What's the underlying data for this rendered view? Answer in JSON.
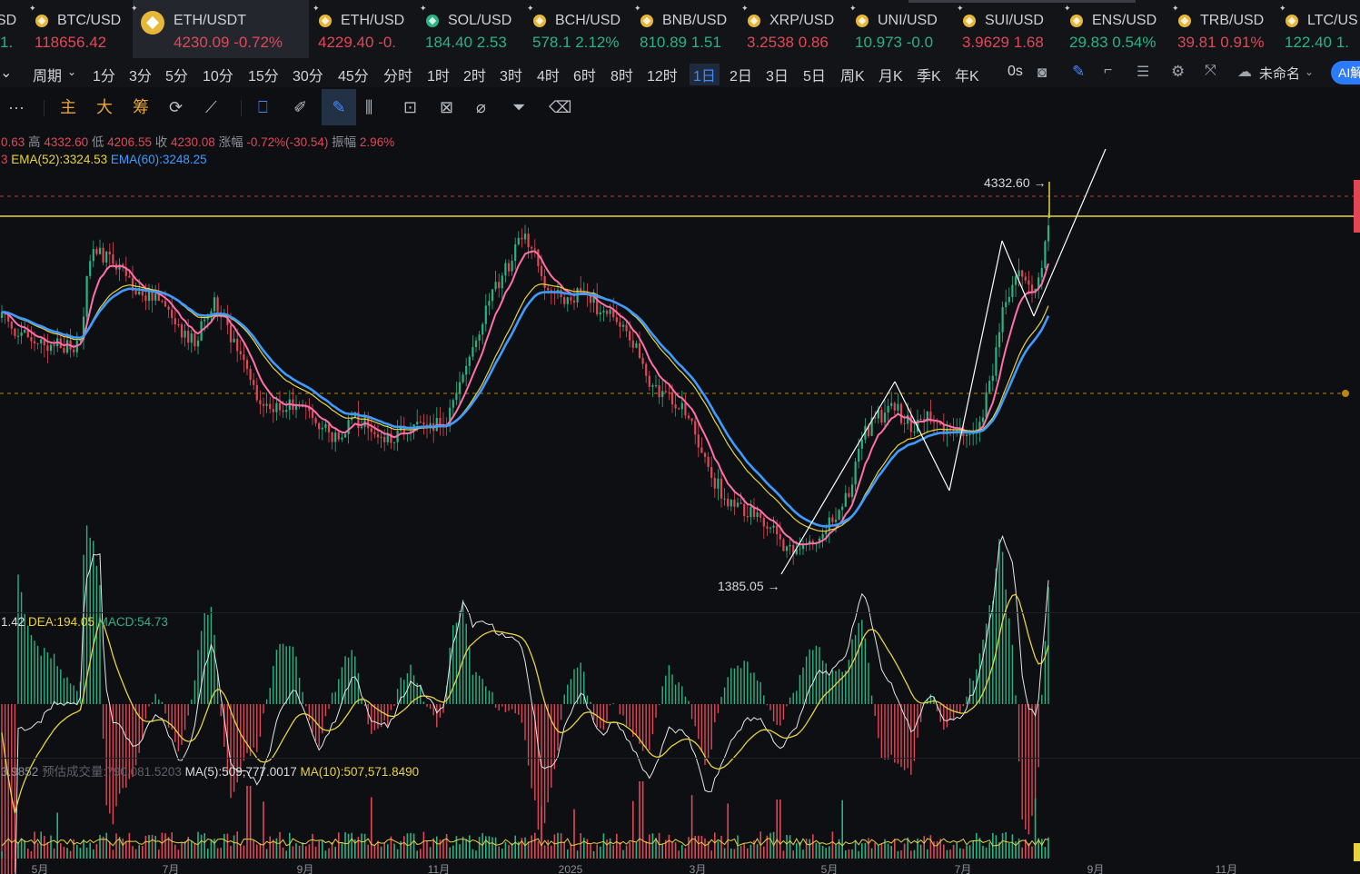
{
  "tickers": [
    {
      "symbol": "SD",
      "price": "1.",
      "dir": "up",
      "active": false
    },
    {
      "symbol": "BTC/USD",
      "price": "118656.42",
      "dir": "down",
      "active": false
    },
    {
      "symbol": "ETH/USDT",
      "price": "4230.09",
      "change": "-0.72%",
      "dir": "down",
      "active": true
    },
    {
      "symbol": "ETH/USD",
      "price": "4229.40",
      "change": "-0.",
      "dir": "down",
      "active": false
    },
    {
      "symbol": "SOL/USD",
      "price": "184.40",
      "change": "2.53",
      "dir": "up",
      "active": false
    },
    {
      "symbol": "BCH/USD",
      "price": "578.1",
      "change": "2.12%",
      "dir": "up",
      "active": false
    },
    {
      "symbol": "BNB/USD",
      "price": "810.89",
      "change": "1.51",
      "dir": "up",
      "active": false
    },
    {
      "symbol": "XRP/USD",
      "price": "3.2538",
      "change": "0.86",
      "dir": "down",
      "active": false
    },
    {
      "symbol": "UNI/USD",
      "price": "10.973",
      "change": "-0.0",
      "dir": "up",
      "active": false
    },
    {
      "symbol": "SUI/USD",
      "price": "3.9629",
      "change": "1.68",
      "dir": "down",
      "active": false
    },
    {
      "symbol": "ENS/USD",
      "price": "29.83",
      "change": "0.54%",
      "dir": "up",
      "active": false
    },
    {
      "symbol": "TRB/USD",
      "price": "39.81",
      "change": "0.91%",
      "dir": "down",
      "active": false
    },
    {
      "symbol": "LTC/US",
      "price": "122.40",
      "change": "1.",
      "dir": "up",
      "active": false
    }
  ],
  "periods": [
    "周期",
    "1分",
    "3分",
    "5分",
    "10分",
    "15分",
    "30分",
    "45分",
    "分时",
    "1时",
    "2时",
    "3时",
    "4时",
    "6时",
    "8时",
    "12时",
    "1日",
    "2日",
    "3日",
    "5日",
    "周K",
    "月K",
    "季K",
    "年K",
    "0s"
  ],
  "selected_period": "1日",
  "layout_name": "未命名",
  "ai_label": "AI解",
  "toolbar": {
    "more": "···",
    "main": "主",
    "big": "大",
    "chip": "筹"
  },
  "ohlc": {
    "open": "0.63",
    "high_label": "高",
    "high": "4332.60",
    "low_label": "低",
    "low": "4206.55",
    "close_label": "收",
    "close": "4230.08",
    "chg_label": "涨幅",
    "chg": "-0.72%(-30.54)",
    "amp_label": "振幅",
    "amp": "2.96%"
  },
  "ema": {
    "prefix": "3",
    "ema52": "EMA(52):3324.53",
    "ema60": "EMA(60):3248.25"
  },
  "macd": {
    "dif": "1.42",
    "dea": "DEA:194.05",
    "macd": "MACD:54.73"
  },
  "volume": {
    "v": "3.9852",
    "est": "预估成交量:790,081.5203",
    "ma5": "MA(5):509,777.0017",
    "ma10": "MA(10):507,571.8490"
  },
  "annotations": {
    "high": "4332.60 →",
    "low": "1385.05 →"
  },
  "colors": {
    "up": "#2bb283",
    "down": "#e04858",
    "accent": "#3f8bff",
    "ema_pink": "#ff6fa8",
    "ema_yellow": "#e8d33f",
    "ema_blue": "#3f9bff"
  },
  "x_axis_labels": [
    "5月",
    "7月",
    "9月",
    "11月",
    "2025",
    "3月",
    "5月",
    "7月",
    "9月",
    "11月"
  ]
}
